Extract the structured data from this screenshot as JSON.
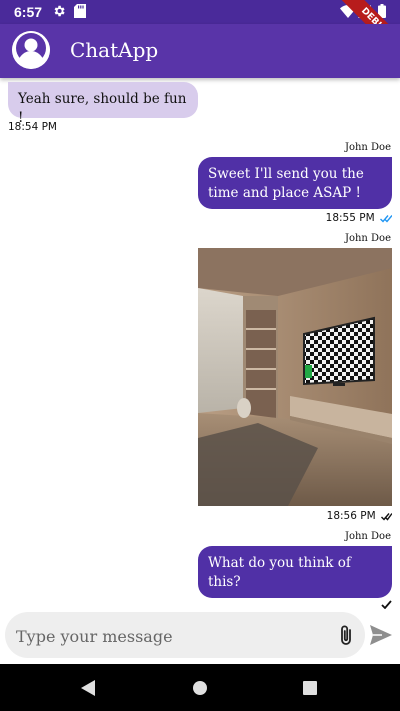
{
  "status_bar": {
    "time": "6:57",
    "debug_label": "DEBUG"
  },
  "app_bar": {
    "title": "ChatApp"
  },
  "messages": [
    {
      "sender": "",
      "text": "Yeah sure, should be fun !",
      "time": "18:54 PM",
      "direction": "incoming"
    },
    {
      "sender": "John Doe",
      "text": "Sweet I'll send you the time and place ASAP !",
      "time": "18:55 PM",
      "direction": "outgoing",
      "status": "read"
    },
    {
      "sender": "John Doe",
      "text": "",
      "image": "living-room-photo",
      "time": "18:56 PM",
      "direction": "outgoing",
      "status": "sent"
    },
    {
      "sender": "John Doe",
      "text": "What do you think of this?",
      "time": "",
      "direction": "outgoing",
      "status": "sent"
    }
  ],
  "composer": {
    "placeholder": "Type your message",
    "value": ""
  },
  "colors": {
    "primary": "#5934a8",
    "status_bar": "#4a2a9a",
    "outgoing_bubble": "#5030a6",
    "incoming_bubble": "#d8ccec",
    "read_tick": "#2196f3"
  },
  "icons": [
    "wifi-icon",
    "signal-icon",
    "battery-icon",
    "gear-icon",
    "sd-card-icon",
    "paperclip-icon",
    "send-icon",
    "back-icon",
    "home-icon",
    "recents-icon"
  ]
}
